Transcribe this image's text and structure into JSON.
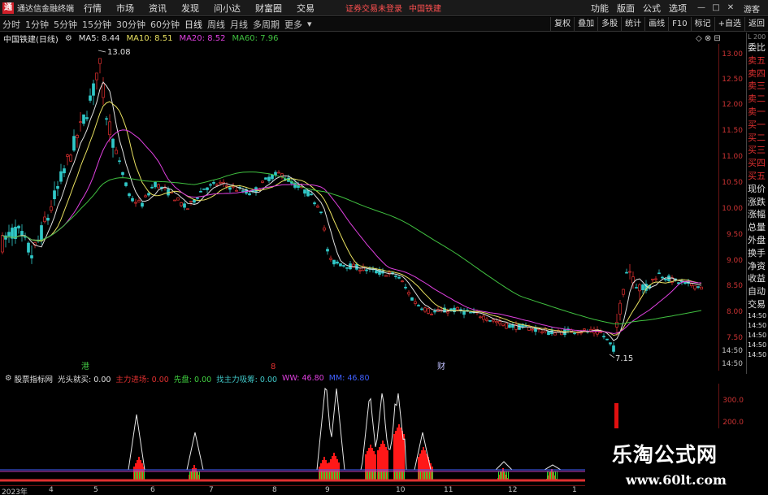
{
  "menubar": {
    "logo_glyph": "通",
    "app_title": "通达信金融终端",
    "items": [
      "行情",
      "市场",
      "资讯",
      "发现",
      "问小达",
      "财富圈",
      "交易"
    ],
    "login_status": "证券交易未登录",
    "stock_name": "中国铁建",
    "right_items": [
      "功能",
      "版面",
      "公式",
      "选项"
    ],
    "guest": "游客"
  },
  "toolbar": {
    "periods": [
      "分时",
      "1分钟",
      "5分钟",
      "15分钟",
      "30分钟",
      "60分钟",
      "日线",
      "周线",
      "月线",
      "多周期",
      "更多"
    ],
    "active_period": "日线",
    "right_buttons": [
      "复权",
      "叠加",
      "多股",
      "统计",
      "画线",
      "F10",
      "标记",
      "+自选",
      "返回"
    ]
  },
  "chart": {
    "title": "中国铁建(日线)",
    "ma": [
      {
        "label": "MA5: 8.44",
        "color": "#e0e0e0"
      },
      {
        "label": "MA10: 8.51",
        "color": "#e8e060"
      },
      {
        "label": "MA20: 8.52",
        "color": "#e040e0"
      },
      {
        "label": "MA60: 7.96",
        "color": "#40c040"
      }
    ],
    "collapse_controls": "◇ ⊗ ⊟",
    "high_mark": "13.08",
    "low_mark": "7.15",
    "price_ticks": [
      "13.00",
      "12.50",
      "12.00",
      "11.50",
      "11.00",
      "10.50",
      "10.00",
      "9.50",
      "9.00",
      "8.50",
      "8.00",
      "7.50",
      "14:50",
      "14:50"
    ],
    "event_marks": [
      {
        "text": "港",
        "color": "#40c040"
      },
      {
        "text": "8",
        "color": "#e03030"
      },
      {
        "text": "财",
        "color": "#c0c0ff"
      }
    ],
    "colors": {
      "up": "#e03030",
      "down": "#30c8c8",
      "axis": "#6b1414"
    }
  },
  "order_book": {
    "corner": "L 200",
    "rows": [
      "委比",
      "卖五",
      "卖四",
      "卖三",
      "卖二",
      "卖一",
      "买一",
      "买二",
      "买三",
      "买四",
      "买五",
      "现价",
      "涨跌",
      "涨幅",
      "总量",
      "外盘",
      "换手",
      "净资",
      "收益",
      "自动",
      "交易",
      "14:50",
      "14:50",
      "14:50",
      "14:50",
      "14:50"
    ]
  },
  "indicator": {
    "name": "股票指标网",
    "labels": [
      {
        "text": "光头就买: 0.00",
        "color": "#e0e0e0"
      },
      {
        "text": "主力进场: 0.00",
        "color": "#e03030"
      },
      {
        "text": "先盘: 0.00",
        "color": "#40d040"
      },
      {
        "text": "找主力吸筹: 0.00",
        "color": "#40c8c8"
      },
      {
        "text": "WW: 46.80",
        "color": "#e040e0"
      },
      {
        "text": "MM: 46.80",
        "color": "#4060ff"
      }
    ],
    "ticks": [
      "300.0",
      "200.0"
    ]
  },
  "time_axis": {
    "labels": [
      "2023年",
      "4",
      "5",
      "6",
      "7",
      "8",
      "9",
      "10",
      "11",
      "12",
      "1"
    ]
  },
  "watermark": {
    "title": "乐淘公式网",
    "url": "www.60lt.com"
  }
}
